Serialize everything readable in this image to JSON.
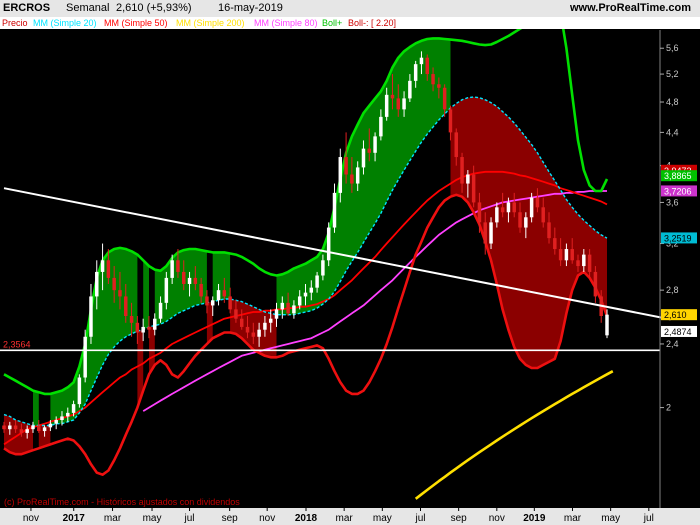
{
  "header": {
    "symbol": "ERCROS",
    "period": "Semanal",
    "quote": "2,610 (+5,93%)",
    "date": "16-may-2019",
    "site": "www.ProRealTime.com"
  },
  "legend": [
    {
      "text": "Precio",
      "color": "#cc0000"
    },
    {
      "text": "MM (Simple 20)",
      "color": "#00e5ff"
    },
    {
      "text": "MM (Simple 50)",
      "color": "#ff0000"
    },
    {
      "text": "MM (Simple 200)",
      "color": "#ffe000"
    },
    {
      "text": "MM (Simple 80)",
      "color": "#ff40ff"
    },
    {
      "text": "Boll+",
      "color": "#00c000"
    },
    {
      "text": "Boll-: [ 2.20]",
      "color": "#cc0000"
    }
  ],
  "watermark": "(c) ProRealTime.com - Históricos ajustados con dividendos",
  "support_label": "2,3564",
  "chart_data": {
    "type": "candlestick",
    "scale": "log",
    "ylim": [
      1.5,
      5.9
    ],
    "yticks": [
      "5,6",
      "5,2",
      "4,8",
      "4,4",
      "4",
      "3,6",
      "3,2",
      "2,8",
      "2,4",
      "2"
    ],
    "ytick_values": [
      5.6,
      5.2,
      4.8,
      4.4,
      4.0,
      3.6,
      3.2,
      2.8,
      2.4,
      2.0
    ],
    "xlabels": [
      {
        "label": "nov",
        "pos": 0.044,
        "bold": false
      },
      {
        "label": "2017",
        "pos": 0.109,
        "bold": true
      },
      {
        "label": "mar",
        "pos": 0.168,
        "bold": false
      },
      {
        "label": "may",
        "pos": 0.228,
        "bold": false
      },
      {
        "label": "jul",
        "pos": 0.285,
        "bold": false
      },
      {
        "label": "sep",
        "pos": 0.346,
        "bold": false
      },
      {
        "label": "nov",
        "pos": 0.403,
        "bold": false
      },
      {
        "label": "2018",
        "pos": 0.462,
        "bold": true
      },
      {
        "label": "mar",
        "pos": 0.52,
        "bold": false
      },
      {
        "label": "may",
        "pos": 0.578,
        "bold": false
      },
      {
        "label": "jul",
        "pos": 0.636,
        "bold": false
      },
      {
        "label": "sep",
        "pos": 0.694,
        "bold": false
      },
      {
        "label": "nov",
        "pos": 0.752,
        "bold": false
      },
      {
        "label": "2019",
        "pos": 0.809,
        "bold": true
      },
      {
        "label": "mar",
        "pos": 0.867,
        "bold": false
      },
      {
        "label": "may",
        "pos": 0.925,
        "bold": false
      },
      {
        "label": "jul",
        "pos": 0.983,
        "bold": false
      }
    ],
    "price_ohlc": [
      [
        1.9,
        1.92,
        1.86,
        1.88
      ],
      [
        1.88,
        1.92,
        1.85,
        1.9
      ],
      [
        1.9,
        1.93,
        1.86,
        1.88
      ],
      [
        1.88,
        1.91,
        1.84,
        1.86
      ],
      [
        1.86,
        1.9,
        1.83,
        1.88
      ],
      [
        1.88,
        1.92,
        1.86,
        1.9
      ],
      [
        1.9,
        1.93,
        1.86,
        1.87
      ],
      [
        1.87,
        1.9,
        1.84,
        1.89
      ],
      [
        1.89,
        1.93,
        1.87,
        1.91
      ],
      [
        1.91,
        1.95,
        1.88,
        1.93
      ],
      [
        1.93,
        1.98,
        1.9,
        1.95
      ],
      [
        1.95,
        2.0,
        1.92,
        1.97
      ],
      [
        1.97,
        2.04,
        1.95,
        2.02
      ],
      [
        2.02,
        2.2,
        2.0,
        2.18
      ],
      [
        2.18,
        2.5,
        2.15,
        2.45
      ],
      [
        2.45,
        2.85,
        2.4,
        2.75
      ],
      [
        2.75,
        3.05,
        2.65,
        2.95
      ],
      [
        2.95,
        3.2,
        2.8,
        3.05
      ],
      [
        3.05,
        3.15,
        2.85,
        2.9
      ],
      [
        2.9,
        3.0,
        2.7,
        2.8
      ],
      [
        2.8,
        2.95,
        2.65,
        2.75
      ],
      [
        2.75,
        2.85,
        2.55,
        2.6
      ],
      [
        2.6,
        2.7,
        2.45,
        2.55
      ],
      [
        2.55,
        2.6,
        2.4,
        2.48
      ],
      [
        2.48,
        2.58,
        2.42,
        2.52
      ],
      [
        2.52,
        2.6,
        2.44,
        2.5
      ],
      [
        2.5,
        2.62,
        2.46,
        2.58
      ],
      [
        2.58,
        2.75,
        2.55,
        2.7
      ],
      [
        2.7,
        2.95,
        2.65,
        2.9
      ],
      [
        2.9,
        3.1,
        2.85,
        3.05
      ],
      [
        3.05,
        3.15,
        2.9,
        2.95
      ],
      [
        2.95,
        3.05,
        2.8,
        2.85
      ],
      [
        2.85,
        2.95,
        2.75,
        2.9
      ],
      [
        2.9,
        3.0,
        2.8,
        2.85
      ],
      [
        2.85,
        2.9,
        2.7,
        2.75
      ],
      [
        2.75,
        2.8,
        2.62,
        2.68
      ],
      [
        2.68,
        2.75,
        2.6,
        2.72
      ],
      [
        2.72,
        2.85,
        2.68,
        2.8
      ],
      [
        2.8,
        2.9,
        2.7,
        2.75
      ],
      [
        2.75,
        2.82,
        2.62,
        2.65
      ],
      [
        2.65,
        2.72,
        2.55,
        2.58
      ],
      [
        2.58,
        2.65,
        2.5,
        2.52
      ],
      [
        2.52,
        2.6,
        2.44,
        2.48
      ],
      [
        2.48,
        2.55,
        2.4,
        2.45
      ],
      [
        2.45,
        2.55,
        2.38,
        2.5
      ],
      [
        2.5,
        2.6,
        2.45,
        2.55
      ],
      [
        2.55,
        2.65,
        2.48,
        2.58
      ],
      [
        2.58,
        2.7,
        2.52,
        2.65
      ],
      [
        2.65,
        2.75,
        2.58,
        2.7
      ],
      [
        2.7,
        2.78,
        2.6,
        2.62
      ],
      [
        2.62,
        2.72,
        2.58,
        2.68
      ],
      [
        2.68,
        2.8,
        2.65,
        2.75
      ],
      [
        2.75,
        2.85,
        2.68,
        2.78
      ],
      [
        2.78,
        2.88,
        2.72,
        2.82
      ],
      [
        2.82,
        2.95,
        2.78,
        2.92
      ],
      [
        2.92,
        3.1,
        2.88,
        3.05
      ],
      [
        3.05,
        3.4,
        3.0,
        3.35
      ],
      [
        3.35,
        3.8,
        3.3,
        3.7
      ],
      [
        3.7,
        4.2,
        3.6,
        4.1
      ],
      [
        4.1,
        4.4,
        3.8,
        3.9
      ],
      [
        3.9,
        4.1,
        3.7,
        3.8
      ],
      [
        3.8,
        4.05,
        3.72,
        3.98
      ],
      [
        3.98,
        4.3,
        3.9,
        4.2
      ],
      [
        4.2,
        4.45,
        4.05,
        4.15
      ],
      [
        4.15,
        4.4,
        4.05,
        4.35
      ],
      [
        4.35,
        4.7,
        4.3,
        4.6
      ],
      [
        4.6,
        5.0,
        4.55,
        4.9
      ],
      [
        4.9,
        5.2,
        4.7,
        4.85
      ],
      [
        4.85,
        5.05,
        4.6,
        4.7
      ],
      [
        4.7,
        4.95,
        4.6,
        4.85
      ],
      [
        4.85,
        5.2,
        4.8,
        5.1
      ],
      [
        5.1,
        5.4,
        5.0,
        5.35
      ],
      [
        5.35,
        5.55,
        5.2,
        5.45
      ],
      [
        5.45,
        5.5,
        5.1,
        5.2
      ],
      [
        5.2,
        5.3,
        4.95,
        5.05
      ],
      [
        5.05,
        5.15,
        4.85,
        5.0
      ],
      [
        5.0,
        5.05,
        4.6,
        4.7
      ],
      [
        4.7,
        4.75,
        4.3,
        4.4
      ],
      [
        4.4,
        4.45,
        4.0,
        4.1
      ],
      [
        4.1,
        4.15,
        3.7,
        3.8
      ],
      [
        3.8,
        3.95,
        3.65,
        3.9
      ],
      [
        3.9,
        4.0,
        3.55,
        3.6
      ],
      [
        3.6,
        3.7,
        3.3,
        3.4
      ],
      [
        3.4,
        3.5,
        3.1,
        3.2
      ],
      [
        3.2,
        3.45,
        3.15,
        3.4
      ],
      [
        3.4,
        3.6,
        3.35,
        3.55
      ],
      [
        3.55,
        3.7,
        3.45,
        3.5
      ],
      [
        3.5,
        3.65,
        3.4,
        3.6
      ],
      [
        3.6,
        3.7,
        3.45,
        3.5
      ],
      [
        3.5,
        3.6,
        3.3,
        3.35
      ],
      [
        3.35,
        3.5,
        3.25,
        3.45
      ],
      [
        3.45,
        3.7,
        3.4,
        3.65
      ],
      [
        3.65,
        3.75,
        3.5,
        3.55
      ],
      [
        3.55,
        3.65,
        3.35,
        3.4
      ],
      [
        3.4,
        3.5,
        3.2,
        3.25
      ],
      [
        3.25,
        3.35,
        3.1,
        3.15
      ],
      [
        3.15,
        3.25,
        3.0,
        3.05
      ],
      [
        3.05,
        3.2,
        3.0,
        3.15
      ],
      [
        3.15,
        3.25,
        3.02,
        3.05
      ],
      [
        3.05,
        3.1,
        2.95,
        3.0
      ],
      [
        3.0,
        3.15,
        2.95,
        3.1
      ],
      [
        3.1,
        3.15,
        2.9,
        2.95
      ],
      [
        2.95,
        3.0,
        2.7,
        2.75
      ],
      [
        2.75,
        2.8,
        2.55,
        2.6
      ],
      [
        2.46,
        2.65,
        2.44,
        2.61
      ]
    ],
    "sma20": [
      1.96,
      1.95,
      1.93,
      1.92,
      1.91,
      1.9,
      1.9,
      1.9,
      1.9,
      1.91,
      1.91,
      1.92,
      1.93,
      1.97,
      2.02,
      2.1,
      2.18,
      2.26,
      2.33,
      2.38,
      2.42,
      2.45,
      2.47,
      2.49,
      2.5,
      2.52,
      2.53,
      2.54,
      2.56,
      2.59,
      2.62,
      2.64,
      2.66,
      2.68,
      2.69,
      2.7,
      2.71,
      2.72,
      2.73,
      2.73,
      2.72,
      2.71,
      2.69,
      2.67,
      2.65,
      2.63,
      2.62,
      2.61,
      2.61,
      2.61,
      2.61,
      2.62,
      2.63,
      2.64,
      2.66,
      2.69,
      2.73,
      2.79,
      2.87,
      2.96,
      3.04,
      3.12,
      3.21,
      3.3,
      3.39,
      3.49,
      3.61,
      3.73,
      3.84,
      3.95,
      4.06,
      4.17,
      4.28,
      4.38,
      4.47,
      4.56,
      4.64,
      4.72,
      4.78,
      4.83,
      4.86,
      4.87,
      4.86,
      4.83,
      4.79,
      4.74,
      4.67,
      4.6,
      4.52,
      4.43,
      4.34,
      4.25,
      4.15,
      4.04,
      3.93,
      3.83,
      3.73,
      3.63,
      3.55,
      3.48,
      3.42,
      3.37,
      3.32,
      3.28,
      3.25
    ],
    "sma50": [
      1.8,
      1.82,
      1.84,
      1.86,
      1.88,
      1.89,
      1.9,
      1.91,
      1.92,
      1.93,
      1.94,
      1.95,
      1.96,
      1.98,
      2.0,
      2.03,
      2.06,
      2.09,
      2.12,
      2.15,
      2.18,
      2.2,
      2.23,
      2.25,
      2.27,
      2.3,
      2.32,
      2.34,
      2.37,
      2.4,
      2.42,
      2.44,
      2.46,
      2.48,
      2.5,
      2.52,
      2.54,
      2.56,
      2.58,
      2.59,
      2.6,
      2.61,
      2.62,
      2.63,
      2.63,
      2.64,
      2.64,
      2.65,
      2.65,
      2.66,
      2.66,
      2.67,
      2.67,
      2.68,
      2.69,
      2.71,
      2.73,
      2.76,
      2.8,
      2.84,
      2.88,
      2.93,
      2.98,
      3.03,
      3.08,
      3.14,
      3.2,
      3.26,
      3.32,
      3.38,
      3.44,
      3.5,
      3.56,
      3.62,
      3.67,
      3.72,
      3.76,
      3.8,
      3.84,
      3.87,
      3.89,
      3.91,
      3.92,
      3.93,
      3.93,
      3.93,
      3.93,
      3.92,
      3.91,
      3.89,
      3.88,
      3.86,
      3.84,
      3.82,
      3.8,
      3.78,
      3.75,
      3.73,
      3.71,
      3.69,
      3.67,
      3.65,
      3.63,
      3.61,
      3.58
    ],
    "sma200": [
      null,
      null,
      null,
      null,
      null,
      null,
      null,
      null,
      null,
      null,
      null,
      null,
      null,
      null,
      null,
      null,
      null,
      null,
      null,
      null,
      null,
      null,
      null,
      null,
      null,
      null,
      null,
      null,
      null,
      null,
      null,
      null,
      null,
      null,
      null,
      null,
      null,
      null,
      null,
      null,
      null,
      null,
      null,
      null,
      null,
      null,
      null,
      null,
      null,
      null,
      null,
      null,
      null,
      null,
      null,
      null,
      null,
      null,
      null,
      null,
      null,
      null,
      null,
      null,
      null,
      null,
      null,
      null,
      null,
      null,
      null,
      1.54,
      1.56,
      1.58,
      1.6,
      1.62,
      1.64,
      1.66,
      1.68,
      1.7,
      1.72,
      1.74,
      1.76,
      1.78,
      1.8,
      1.82,
      1.84,
      1.86,
      1.88,
      1.9,
      1.92,
      1.94,
      1.96,
      1.98,
      2.0,
      2.02,
      2.04,
      2.06,
      2.08,
      2.1,
      2.12,
      2.14,
      2.16,
      2.18,
      2.2,
      2.22
    ],
    "sma80": [
      null,
      null,
      null,
      null,
      null,
      null,
      null,
      null,
      null,
      null,
      null,
      null,
      null,
      null,
      null,
      null,
      null,
      null,
      null,
      null,
      null,
      null,
      null,
      null,
      1.98,
      2.0,
      2.02,
      2.04,
      2.06,
      2.08,
      2.1,
      2.12,
      2.14,
      2.16,
      2.18,
      2.2,
      2.22,
      2.24,
      2.26,
      2.28,
      2.3,
      2.32,
      2.33,
      2.34,
      2.35,
      2.36,
      2.37,
      2.38,
      2.39,
      2.4,
      2.41,
      2.42,
      2.43,
      2.44,
      2.46,
      2.48,
      2.5,
      2.53,
      2.56,
      2.59,
      2.62,
      2.65,
      2.68,
      2.72,
      2.76,
      2.8,
      2.84,
      2.88,
      2.93,
      2.98,
      3.03,
      3.08,
      3.13,
      3.18,
      3.23,
      3.28,
      3.32,
      3.36,
      3.4,
      3.43,
      3.46,
      3.49,
      3.52,
      3.54,
      3.56,
      3.58,
      3.6,
      3.61,
      3.62,
      3.63,
      3.64,
      3.65,
      3.66,
      3.67,
      3.68,
      3.69,
      3.69,
      3.7,
      3.7,
      3.71,
      3.71,
      3.72,
      3.72,
      3.72,
      3.72
    ],
    "boll_plus": [
      2.2,
      2.18,
      2.16,
      2.14,
      2.12,
      2.1,
      2.09,
      2.08,
      2.08,
      2.09,
      2.1,
      2.12,
      2.15,
      2.25,
      2.4,
      2.65,
      2.9,
      3.05,
      3.12,
      3.15,
      3.16,
      3.15,
      3.13,
      3.1,
      3.05,
      3.0,
      2.97,
      2.96,
      3.0,
      3.07,
      3.12,
      3.14,
      3.15,
      3.15,
      3.14,
      3.13,
      3.12,
      3.12,
      3.12,
      3.11,
      3.1,
      3.08,
      3.05,
      3.02,
      2.98,
      2.95,
      2.93,
      2.92,
      2.93,
      2.95,
      2.98,
      3.0,
      3.02,
      3.05,
      3.08,
      3.15,
      3.3,
      3.55,
      3.85,
      4.15,
      4.35,
      4.5,
      4.65,
      4.75,
      4.85,
      4.95,
      5.1,
      5.3,
      5.45,
      5.55,
      5.62,
      5.68,
      5.72,
      5.75,
      5.76,
      5.76,
      5.75,
      5.74,
      5.73,
      5.72,
      5.7,
      5.68,
      5.66,
      5.65,
      5.66,
      5.7,
      5.75,
      5.8,
      5.86,
      5.92,
      5.98,
      6.05,
      6.15,
      6.25,
      6.35,
      6.4,
      6.2,
      5.6,
      4.9,
      4.3,
      3.95,
      3.78,
      3.72,
      3.72,
      3.85
    ],
    "boll_minus": [
      1.78,
      1.76,
      1.75,
      1.75,
      1.76,
      1.77,
      1.78,
      1.79,
      1.8,
      1.81,
      1.82,
      1.83,
      1.82,
      1.79,
      1.75,
      1.7,
      1.66,
      1.65,
      1.67,
      1.72,
      1.78,
      1.85,
      1.92,
      2.0,
      2.1,
      2.2,
      2.26,
      2.29,
      2.26,
      2.2,
      2.18,
      2.22,
      2.27,
      2.32,
      2.36,
      2.4,
      2.44,
      2.46,
      2.48,
      2.48,
      2.47,
      2.44,
      2.4,
      2.36,
      2.34,
      2.32,
      2.31,
      2.31,
      2.32,
      2.34,
      2.35,
      2.36,
      2.37,
      2.38,
      2.39,
      2.37,
      2.3,
      2.22,
      2.15,
      2.1,
      2.08,
      2.08,
      2.1,
      2.15,
      2.22,
      2.3,
      2.4,
      2.52,
      2.66,
      2.8,
      2.95,
      3.1,
      3.22,
      3.35,
      3.45,
      3.55,
      3.62,
      3.66,
      3.68,
      3.66,
      3.6,
      3.5,
      3.38,
      3.22,
      3.05,
      2.85,
      2.65,
      2.5,
      2.38,
      2.3,
      2.26,
      2.24,
      2.24,
      2.26,
      2.28,
      2.3,
      2.42,
      2.62,
      2.8,
      2.92,
      2.95,
      2.9,
      2.82,
      2.72,
      2.6
    ],
    "trendline": {
      "from": [
        0,
        3.75
      ],
      "to": [
        106,
        2.65
      ]
    },
    "support": 2.3564,
    "price_boxes": [
      {
        "text": "3,9473",
        "value": 3.9473,
        "bg": "#cc0000",
        "fg": "#ffffff"
      },
      {
        "text": "3,8865",
        "value": 3.8865,
        "bg": "#00c000",
        "fg": "#ffffff"
      },
      {
        "text": "3,7206",
        "value": 3.7206,
        "bg": "#cc33cc",
        "fg": "#ffffff"
      },
      {
        "text": "3,2519",
        "value": 3.2519,
        "bg": "#00bcd4",
        "fg": "#000000"
      },
      {
        "text": "2,610",
        "value": 2.61,
        "bg": "#ffd400",
        "fg": "#000000"
      },
      {
        "text": "2,4874",
        "value": 2.4874,
        "bg": "#ffffff",
        "fg": "#000000"
      }
    ],
    "colors": {
      "up": "#ffffff",
      "down": "#e02020",
      "fill_up": "#008000",
      "fill_down": "#8b0000",
      "sma20": "#00e5ff",
      "sma50": "#ff0000",
      "sma200": "#ffe000",
      "sma80": "#ff40ff",
      "boll_plus": "#00e000",
      "boll_minus": "#ee1010",
      "lines": "#ffffff",
      "axis_text": "#c8c8c8"
    }
  }
}
